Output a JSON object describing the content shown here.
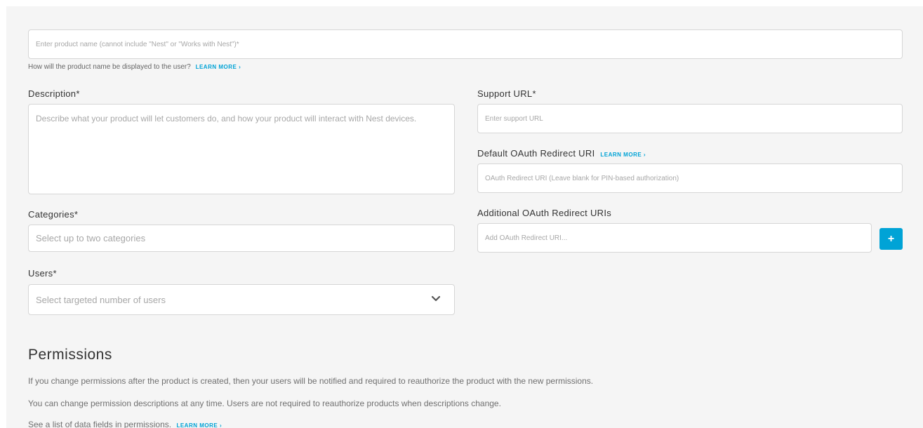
{
  "product_name": {
    "placeholder": "Enter product name (cannot include \"Nest\" or \"Works with Nest\")*",
    "hint": "How will the product name be displayed to the user?",
    "learn_more": "LEARN MORE ›"
  },
  "description": {
    "label": "Description*",
    "placeholder": "Describe what your product will let customers do, and how your product will interact with Nest devices."
  },
  "support_url": {
    "label": "Support URL*",
    "placeholder": "Enter support URL"
  },
  "default_oauth": {
    "label": "Default OAuth Redirect URI",
    "learn_more": "LEARN MORE ›",
    "placeholder": "OAuth Redirect URI (Leave blank for PIN-based authorization)"
  },
  "categories": {
    "label": "Categories*",
    "placeholder": "Select up to two categories"
  },
  "additional_oauth": {
    "label": "Additional OAuth Redirect URIs",
    "placeholder": "Add OAuth Redirect URI...",
    "add_button": "+"
  },
  "users": {
    "label": "Users*",
    "selected": "Select targeted number of users"
  },
  "permissions": {
    "title": "Permissions",
    "line1": "If you change permissions after the product is created, then your users will be notified and required to reauthorize the product with the new permissions.",
    "line2": "You can change permission descriptions at any time. Users are not required to reauthorize products when descriptions change.",
    "line3": "See a list of data fields in permissions.",
    "learn_more": "LEARN MORE ›"
  },
  "colors": {
    "accent": "#00a3d6",
    "panel_bg": "#f5f5f5",
    "border": "#d6d6d6"
  }
}
